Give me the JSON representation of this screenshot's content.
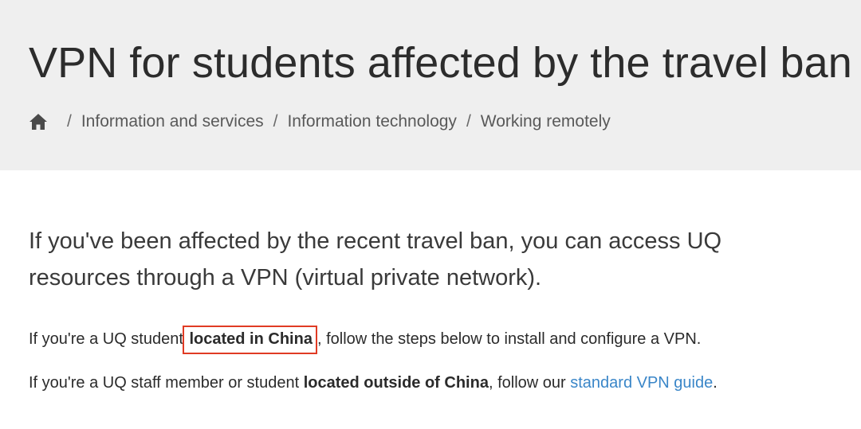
{
  "page": {
    "title": "VPN for students affected by the travel ban"
  },
  "breadcrumb": {
    "home_icon": "home-icon",
    "separator": "/",
    "items": [
      "Information and services",
      "Information technology",
      "Working remotely"
    ]
  },
  "content": {
    "lead": "If you've been affected by the recent travel ban, you can access UQ resources through a VPN (virtual private network).",
    "paragraph1": {
      "before": "If you're a UQ student ",
      "emphasis": "located in China",
      "after": ", follow the steps below to install and configure a VPN."
    },
    "paragraph2": {
      "before": "If you're a UQ staff member or student ",
      "emphasis": "located outside of China",
      "middle": ", follow our ",
      "link": "standard VPN guide",
      "after": "."
    }
  },
  "colors": {
    "header_bg": "#efefef",
    "link": "#3a86c8",
    "highlight_border": "#e03b24"
  }
}
